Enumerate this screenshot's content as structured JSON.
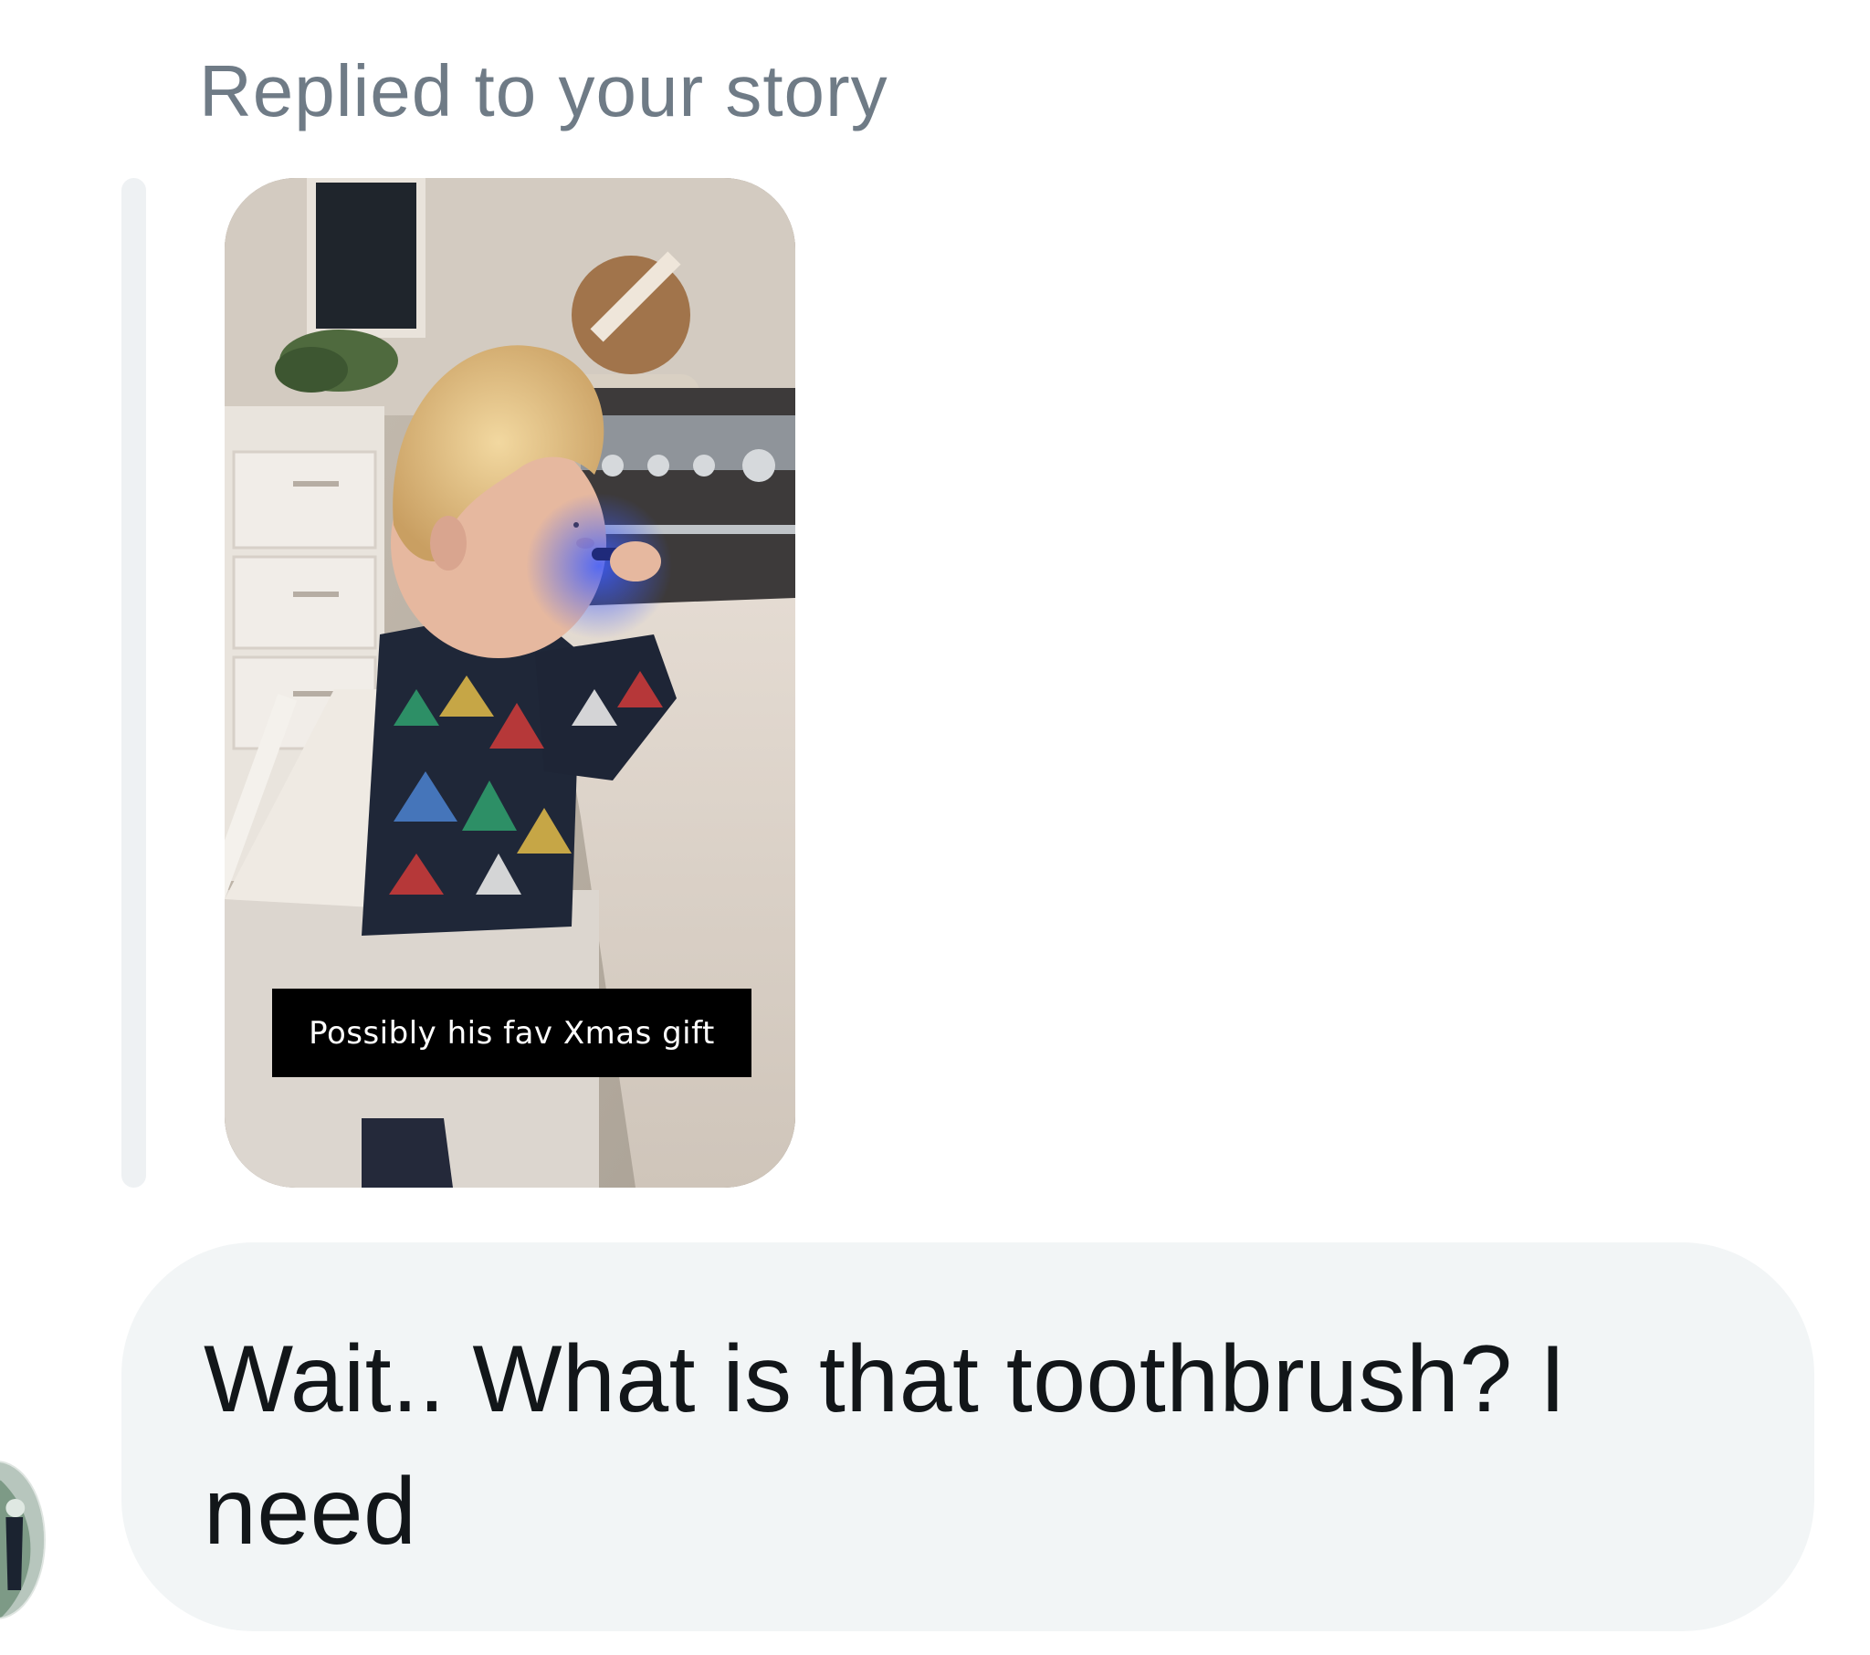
{
  "conversation": {
    "reply_context": "Replied to your story",
    "story": {
      "caption": "Possibly his fav Xmas gift"
    },
    "message": {
      "text": "Wait.. What is that toothbrush? I need"
    }
  }
}
